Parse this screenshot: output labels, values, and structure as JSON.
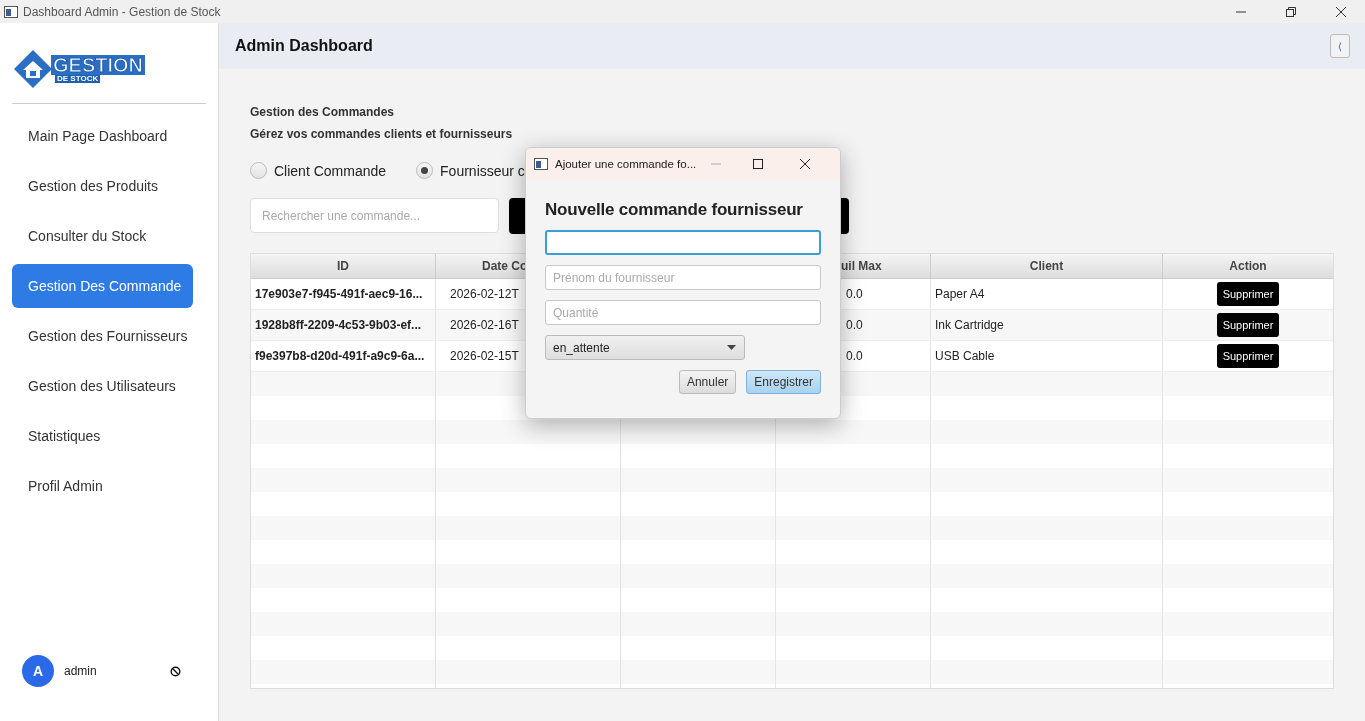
{
  "window": {
    "title": "Dashboard Admin - Gestion de Stock"
  },
  "sidebar": {
    "logo": {
      "title": "GESTION",
      "subtitle": "DE STOCK"
    },
    "items": [
      {
        "label": "Main Page Dashboard",
        "selected": false
      },
      {
        "label": "Gestion des Produits",
        "selected": false
      },
      {
        "label": "Consulter du Stock",
        "selected": false
      },
      {
        "label": "Gestion Des Commande",
        "selected": true
      },
      {
        "label": "Gestion des Fournisseurs",
        "selected": false
      },
      {
        "label": "Gestion des Utilisateurs",
        "selected": false
      },
      {
        "label": "Statistiques",
        "selected": false
      },
      {
        "label": "Profil Admin",
        "selected": false
      }
    ],
    "user": {
      "initial": "A",
      "name": "admin"
    }
  },
  "header": {
    "title": "Admin Dashboard",
    "collapse_button": "⟨"
  },
  "content": {
    "heading": "Gestion des Commandes",
    "subheading": "Gérez vos commandes clients et fournisseurs",
    "radios": [
      {
        "label": "Client Commande",
        "selected": false
      },
      {
        "label": "Fournisseur c",
        "selected": true
      }
    ],
    "search": {
      "placeholder": "Rechercher une commande..."
    },
    "table": {
      "columns": [
        {
          "label": "ID"
        },
        {
          "label": "Date Co"
        },
        {
          "label": "uil Max"
        },
        {
          "label": "Client"
        },
        {
          "label": "Action"
        }
      ],
      "rows": [
        {
          "id": "17e903e7-f945-491f-aec9-16...",
          "date": "2026-02-12T",
          "seuil": "0.0",
          "client": "Paper A4",
          "action": "Supprimer"
        },
        {
          "id": "1928b8ff-2209-4c53-9b03-ef...",
          "date": "2026-02-16T",
          "seuil": "0.0",
          "client": "Ink Cartridge",
          "action": "Supprimer"
        },
        {
          "id": "f9e397b8-d20d-491f-a9c9-6a...",
          "date": "2026-02-15T",
          "seuil": "0.0",
          "client": "USB Cable",
          "action": "Supprimer"
        }
      ]
    }
  },
  "dialog": {
    "title": "Ajouter une commande fo...",
    "heading": "Nouvelle commande fournisseur",
    "fields": [
      {
        "focused": true
      },
      {
        "placeholder": "Prénom du fournisseur",
        "focused": false
      },
      {
        "placeholder": "Quantité",
        "focused": false
      }
    ],
    "select": {
      "value": "en_attente"
    },
    "buttons": [
      {
        "label": "Annuler",
        "default": false
      },
      {
        "label": "Enregistrer",
        "default": true
      }
    ]
  }
}
